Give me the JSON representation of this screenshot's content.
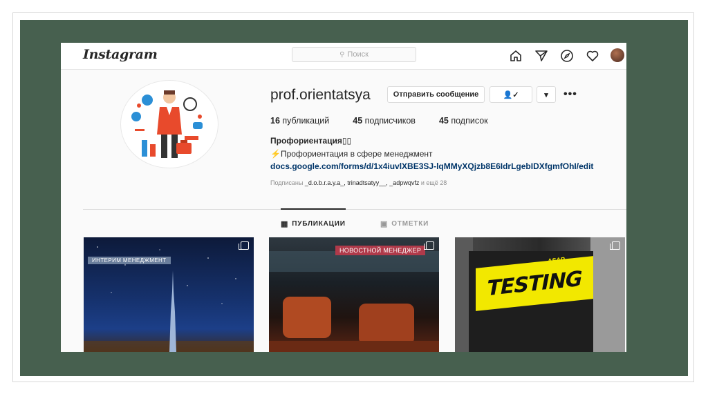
{
  "app": {
    "logo": "Instagram",
    "search_placeholder": "Поиск"
  },
  "nav": {
    "icons": [
      "home-icon",
      "send-icon",
      "explore-icon",
      "heart-icon"
    ]
  },
  "profile": {
    "username": "prof.orientatsya",
    "message_button": "Отправить сообщение",
    "follow_button_icon": "👤✓",
    "dropdown_icon": "▾",
    "more_icon": "•••",
    "stats": {
      "posts_count": "16",
      "posts_label": "публикаций",
      "followers_count": "45",
      "followers_label": "подписчиков",
      "following_count": "45",
      "following_label": "подписок"
    },
    "bio_name": "Профориентация",
    "bio_name_suffix": "▯▯",
    "bio_text": "⚡Профориентация в сфере менеджмент",
    "bio_link": "docs.google.com/forms/d/1x4iuvlXBE3SJ-lqMMyXQjzb8E6IdrLgebIDXfgmfOhI/edit",
    "followed_by_prefix": "Подписаны",
    "followed_by_names": "_d.o.b.r.a.y.a_, trinadtsatyy__, _adpwqvfz",
    "followed_by_suffix": "и ещё 28"
  },
  "tabs": {
    "posts": "ПУБЛИКАЦИИ",
    "tagged": "ОТМЕТКИ",
    "active": "posts"
  },
  "posts": [
    {
      "caption": "ИНТЕРИМ МЕНЕДЖМЕНТ"
    },
    {
      "caption": "НОВОСТНОЙ МЕНЕДЖЕР"
    },
    {
      "caption_top": "ASAP",
      "caption": "TESTING"
    }
  ],
  "colors": {
    "slide_frame": "#47604f",
    "link": "#003569",
    "text": "#262626",
    "muted": "#8e8e8e"
  }
}
